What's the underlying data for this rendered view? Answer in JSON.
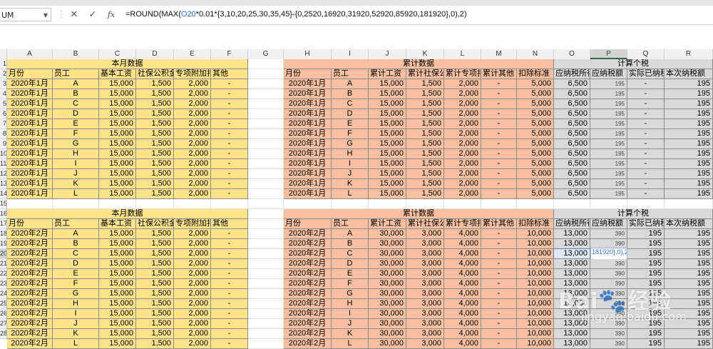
{
  "namebox": {
    "value": "UM"
  },
  "formula_bar": {
    "cancel_glyph": "✕",
    "enter_glyph": "✓",
    "fx_glyph": "fx",
    "parts": [
      "=ROUND(MAX(",
      "O20",
      "*0.01*{3,10,20,25,30,35,45}-{0,2520,16920,31920,52920,85920,181920},0),2)"
    ]
  },
  "columns": [
    "A",
    "B",
    "C",
    "D",
    "E",
    "F",
    "G",
    "H",
    "I",
    "J",
    "K",
    "L",
    "M",
    "N",
    "O",
    "P",
    "Q",
    "R"
  ],
  "selected_column": "P",
  "row_numbers": [
    "1",
    "2",
    "3",
    "4",
    "5",
    "6",
    "7",
    "8",
    "9",
    "10",
    "11",
    "12",
    "13",
    "14",
    "15",
    "16",
    "17",
    "18",
    "19",
    "20",
    "21",
    "22",
    "23",
    "24",
    "25",
    "26",
    "27",
    "28"
  ],
  "selected_row": "20",
  "block1": {
    "monthly_title": "本月数据",
    "cumulative_title": "累计数据",
    "tax_title": "计算个税",
    "headers_left": [
      "月份",
      "员工",
      "基本工资",
      "社保公积金",
      "专项附加扣",
      "其他"
    ],
    "headers_right": [
      "月份",
      "员工",
      "累计工资",
      "累计社保公",
      "累计专项扣",
      "累计其他",
      "扣除标准",
      "应纳税所得",
      "应纳税额",
      "实际已纳税",
      "本次纳税额"
    ],
    "month": "2020年1月",
    "employees": [
      "A",
      "B",
      "C",
      "D",
      "E",
      "F",
      "G",
      "H",
      "I",
      "J",
      "K",
      "L"
    ],
    "left_values": [
      "15,000",
      "1,500",
      "2,000",
      "-"
    ],
    "right_values": [
      "15,000",
      "1,500",
      "2,000",
      "-",
      "5,000",
      "6,500",
      "195",
      "-",
      "195"
    ]
  },
  "block2": {
    "monthly_title": "本月数据",
    "cumulative_title": "累计数据",
    "tax_title": "计算个税",
    "headers_left": [
      "月份",
      "员工",
      "基本工资",
      "社保公积金",
      "专项附加扣",
      "其他"
    ],
    "headers_right": [
      "月份",
      "员工",
      "累计工资",
      "累计社保公",
      "累计专项扣",
      "累计其他",
      "扣除标准",
      "应纳税所得",
      "应纳税额",
      "实际已纳税",
      "本次纳税额"
    ],
    "month": "2020年2月",
    "employees": [
      "A",
      "B",
      "C",
      "D",
      "E",
      "F",
      "G",
      "H",
      "I",
      "J",
      "K",
      "L"
    ],
    "left_values": [
      "15,000",
      "1,500",
      "2,000",
      "-"
    ],
    "right_values": [
      "30,000",
      "3,000",
      "4,000",
      "-",
      "10,000",
      "13,000",
      "390",
      "195",
      "195"
    ],
    "editing_cell_text": "181920},0),2)"
  },
  "watermark": {
    "brand": "Bai",
    "brand_cn": "经验",
    "domain": "jingyan.baidu.com"
  },
  "colors": {
    "yellow": "#ffe38a",
    "orange": "#f8c0a0",
    "grey": "#d9d9d9",
    "selection": "#217346"
  }
}
